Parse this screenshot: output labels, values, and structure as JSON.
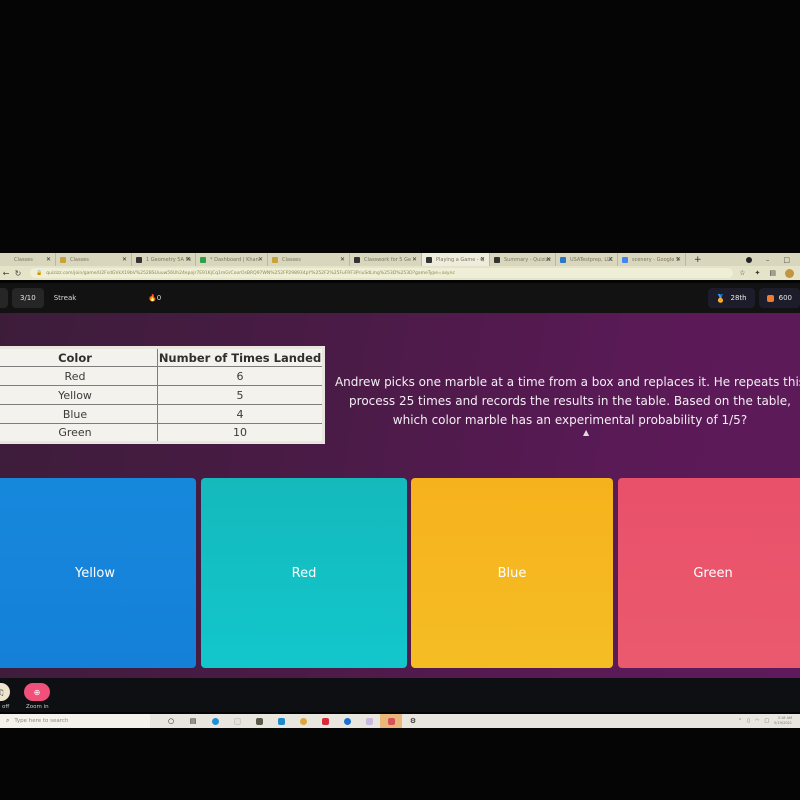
{
  "browser": {
    "tabs": [
      {
        "label": "Classes",
        "favicon_color": "#d8d6bc",
        "active": false
      },
      {
        "label": "Classes",
        "favicon_color": "#c9a23a",
        "active": false
      },
      {
        "label": "1 Geometry 5A Mo",
        "favicon_color": "#333333",
        "active": false
      },
      {
        "label": "* Dashboard | Khan",
        "favicon_color": "#2f9f4a",
        "active": false
      },
      {
        "label": "Classes",
        "favicon_color": "#c9a23a",
        "active": false
      },
      {
        "label": "Classwork for 5 Ge",
        "favicon_color": "#333333",
        "active": false
      },
      {
        "label": "Playing a Game - Q",
        "favicon_color": "#333333",
        "active": true
      },
      {
        "label": "Summary - Quizizz",
        "favicon_color": "#333333",
        "active": false
      },
      {
        "label": "USATestprep, LLC -",
        "favicon_color": "#2a77c7",
        "active": false
      },
      {
        "label": "scenery - Google S",
        "favicon_color": "#4285f4",
        "active": false
      }
    ],
    "new_tab": "+",
    "url": "quizizz.com/join/game/U2FsdGVkX19bV%252BSUuuw56Uh24epojr7E91KjCq1mGrCoorOsBRQ97WN%252FP298934pY%252F2%25FuFRF3PriuSdLmg%253D%253D?gameType=async",
    "icons": {
      "back": "←",
      "reload": "↻",
      "lock": "🔒",
      "star": "☆",
      "extensions": "✦",
      "media": "▤"
    }
  },
  "quiz_header": {
    "progress": "3/10",
    "streak_label": "Streak",
    "streak_count": "0",
    "rank": "28th",
    "score": "600"
  },
  "question": {
    "table": {
      "headers": [
        "Color",
        "Number of Times Landed"
      ],
      "rows": [
        [
          "Red",
          "6"
        ],
        [
          "Yellow",
          "5"
        ],
        [
          "Blue",
          "4"
        ],
        [
          "Green",
          "10"
        ]
      ]
    },
    "text": "Andrew picks one marble at a time from a box and replaces it. He repeats this process 25 times and records the results in the table. Based on the table, which color marble has an experimental probability of 1/5?"
  },
  "options": [
    {
      "label": "Yellow",
      "color": "#1688dc"
    },
    {
      "label": "Red",
      "color": "#14c0c4"
    },
    {
      "label": "Blue",
      "color": "#f5b820"
    },
    {
      "label": "Green",
      "color": "#ea5570"
    }
  ],
  "controls": {
    "off_label": "off",
    "zoom_label": "Zoom in"
  },
  "taskbar": {
    "search_placeholder": "Type here to search",
    "clock_time": "3:18 AM",
    "clock_date": "5/19/2021"
  }
}
